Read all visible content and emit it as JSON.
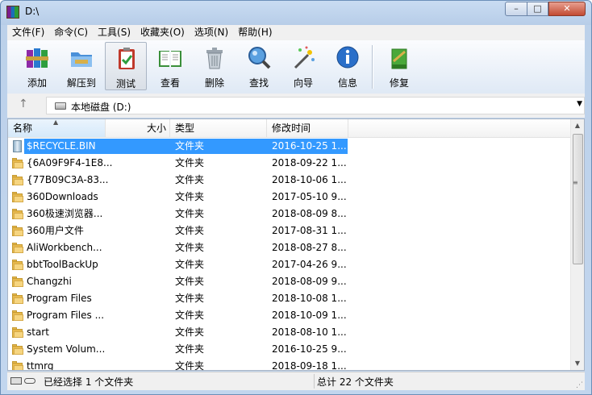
{
  "window": {
    "title": "D:\\"
  },
  "menu": [
    "文件(F)",
    "命令(C)",
    "工具(S)",
    "收藏夹(O)",
    "选项(N)",
    "帮助(H)"
  ],
  "toolbar": {
    "add": "添加",
    "extract": "解压到",
    "test": "测试",
    "view": "查看",
    "delete": "删除",
    "find": "查找",
    "wizard": "向导",
    "info": "信息",
    "repair": "修复"
  },
  "address": {
    "path": "本地磁盘 (D:)"
  },
  "list": {
    "columns": {
      "name": "名称",
      "size": "大小",
      "type": "类型",
      "modified": "修改时间"
    },
    "rows": [
      {
        "name": "$RECYCLE.BIN",
        "type": "文件夹",
        "modified": "2016-10-25 1...",
        "icon": "recycle-bin-icon",
        "selected": true
      },
      {
        "name": "{6A09F9F4-1E8...",
        "type": "文件夹",
        "modified": "2018-09-22 1...",
        "icon": "folder-icon"
      },
      {
        "name": "{77B09C3A-83...",
        "type": "文件夹",
        "modified": "2018-10-06 1...",
        "icon": "folder-icon"
      },
      {
        "name": "360Downloads",
        "type": "文件夹",
        "modified": "2017-05-10 9...",
        "icon": "folder-icon"
      },
      {
        "name": "360极速浏览器...",
        "type": "文件夹",
        "modified": "2018-08-09 8...",
        "icon": "folder-icon"
      },
      {
        "name": "360用户文件",
        "type": "文件夹",
        "modified": "2017-08-31 1...",
        "icon": "folder-icon"
      },
      {
        "name": "AliWorkbench...",
        "type": "文件夹",
        "modified": "2018-08-27 8...",
        "icon": "folder-icon"
      },
      {
        "name": "bbtToolBackUp",
        "type": "文件夹",
        "modified": "2017-04-26 9...",
        "icon": "folder-icon"
      },
      {
        "name": "Changzhi",
        "type": "文件夹",
        "modified": "2018-08-09 9...",
        "icon": "folder-icon"
      },
      {
        "name": "Program Files",
        "type": "文件夹",
        "modified": "2018-10-08 1...",
        "icon": "folder-icon"
      },
      {
        "name": "Program Files ...",
        "type": "文件夹",
        "modified": "2018-10-09 1...",
        "icon": "folder-icon"
      },
      {
        "name": "start",
        "type": "文件夹",
        "modified": "2018-08-10 1...",
        "icon": "folder-icon"
      },
      {
        "name": "System Volum...",
        "type": "文件夹",
        "modified": "2016-10-25 9...",
        "icon": "folder-icon"
      },
      {
        "name": "ttmrg",
        "type": "文件夹",
        "modified": "2018-09-18 1...",
        "icon": "folder-icon"
      }
    ]
  },
  "status": {
    "left": "已经选择 1 个文件夹",
    "right": "总计 22 个文件夹"
  },
  "colors": {
    "selection": "#3399ff",
    "chrome": "#bcd1ea"
  }
}
